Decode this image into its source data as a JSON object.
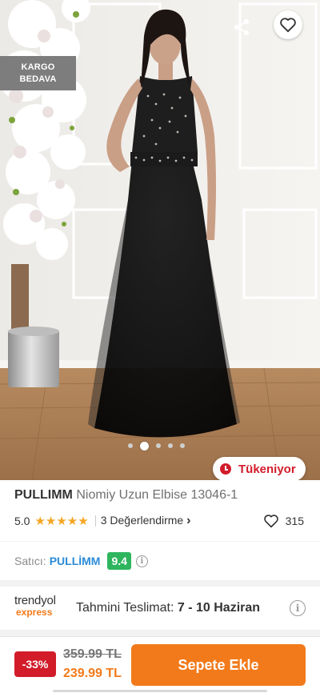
{
  "hero": {
    "cargo_badge": {
      "line1": "KARGO",
      "line2": "BEDAVA"
    },
    "carousel": {
      "count": 5,
      "active": 1
    },
    "stock_badge": "Tükeniyor",
    "icons": {
      "back": "back-arrow-icon",
      "share": "share-icon",
      "favorite": "heart-icon"
    }
  },
  "product": {
    "brand": "PULLIMM",
    "name": "Niomiy Uzun Elbise 13046-1",
    "rating": "5.0",
    "stars": "★★★★★",
    "reviews": "3 Değerlendirme",
    "reviews_chevron": "›",
    "favorites": "315"
  },
  "seller": {
    "label": "Satıcı:",
    "name": "PULLİMM",
    "score": "9.4",
    "info_symbol": "i"
  },
  "delivery": {
    "logo_line1": "trendyol",
    "logo_line2": "express",
    "label": "Tahmini Teslimat:",
    "value": "7 - 10 Haziran",
    "info_symbol": "i"
  },
  "purchase": {
    "discount": "-33%",
    "old_price": "359.99 TL",
    "new_price": "239.99 TL",
    "cart_button": "Sepete Ekle"
  },
  "colors": {
    "accent": "#f27a1a",
    "danger": "#d21c2a",
    "seller_link": "#2b8bd8",
    "score_bg": "#2eb55e",
    "star": "#f5a623"
  }
}
